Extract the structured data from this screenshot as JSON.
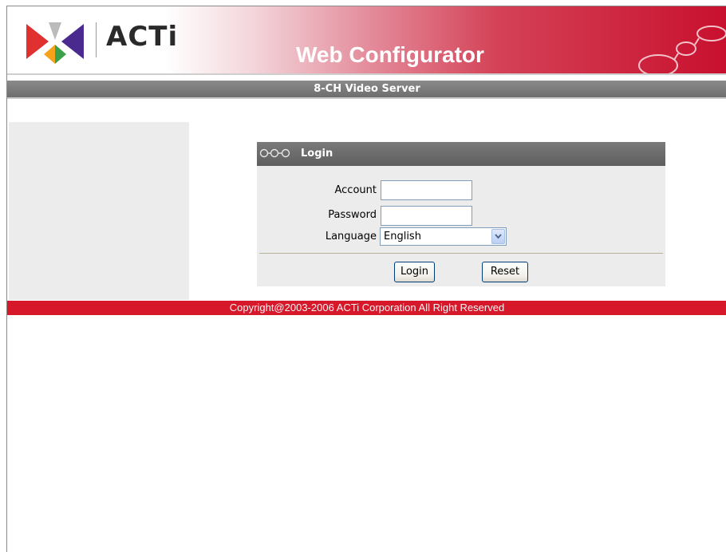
{
  "header": {
    "logo_text": "ACTi",
    "title": "Web Configurator",
    "subtitle": "8-CH Video Server"
  },
  "login": {
    "title": "Login",
    "account_label": "Account",
    "account_value": "",
    "password_label": "Password",
    "password_value": "",
    "language_label": "Language",
    "language_selected": "English",
    "login_button": "Login",
    "reset_button": "Reset"
  },
  "footer": {
    "copyright": "Copyright@2003-2006 ACTi Corporation All Right Reserved"
  },
  "colors": {
    "brand_red": "#c8102e",
    "footer_red": "#d7182a",
    "bar_gray": "#6e6e6e",
    "panel_gray": "#ececec"
  },
  "icons": [
    "acti-logo-icon",
    "rings-decoration-icon",
    "chain-links-icon",
    "chevron-down-icon"
  ]
}
